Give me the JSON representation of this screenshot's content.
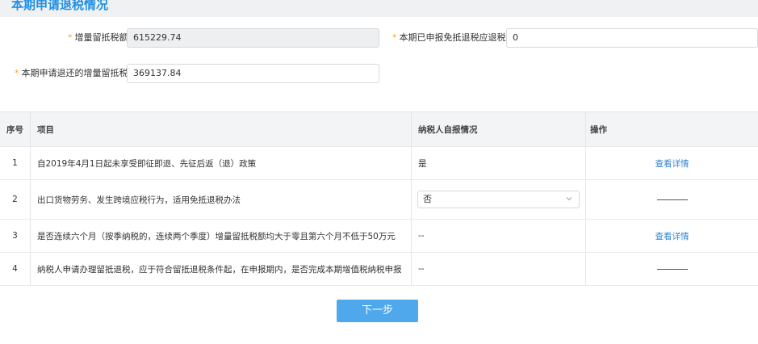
{
  "section": {
    "title": "本期申请退税情况"
  },
  "form": {
    "incremental_credit": {
      "label": "增量留抵税额：",
      "value": "615229.74"
    },
    "declared_exempt_credit": {
      "label": "本期已申报免抵退税应退税额：",
      "value": "0"
    },
    "apply_refund_credit": {
      "label": "本期申请退还的增量留抵税额：",
      "value": "369137.84"
    }
  },
  "table": {
    "headers": {
      "no": "序号",
      "item": "项目",
      "self_report": "纳税人自报情况",
      "action": "操作"
    },
    "rows": [
      {
        "no": "1",
        "item": "自2019年4月1日起未享受即征即退、先征后返（退）政策",
        "self_report": "是",
        "action": "查看详情"
      },
      {
        "no": "2",
        "item": "出口货物劳务、发生跨境应税行为，适用免抵退税办法",
        "self_report": "否",
        "action": "——"
      },
      {
        "no": "3",
        "item": "是否连续六个月（按季纳税的，连续两个季度）增量留抵税额均大于零且第六个月不低于50万元",
        "self_report": "--",
        "action": "查看详情"
      },
      {
        "no": "4",
        "item": "纳税人申请办理留抵退税，应于符合留抵退税条件起，在申报期内，是否完成本期增值税纳税申报",
        "self_report": "--",
        "action": "——"
      }
    ]
  },
  "buttons": {
    "next": "下一步"
  },
  "icons": {
    "dropdown": "chevron-down-icon"
  },
  "colors": {
    "accent": "#1f8fe5",
    "link": "#2f86d4",
    "required_star": "#f5a623",
    "button": "#4fa8ec"
  }
}
